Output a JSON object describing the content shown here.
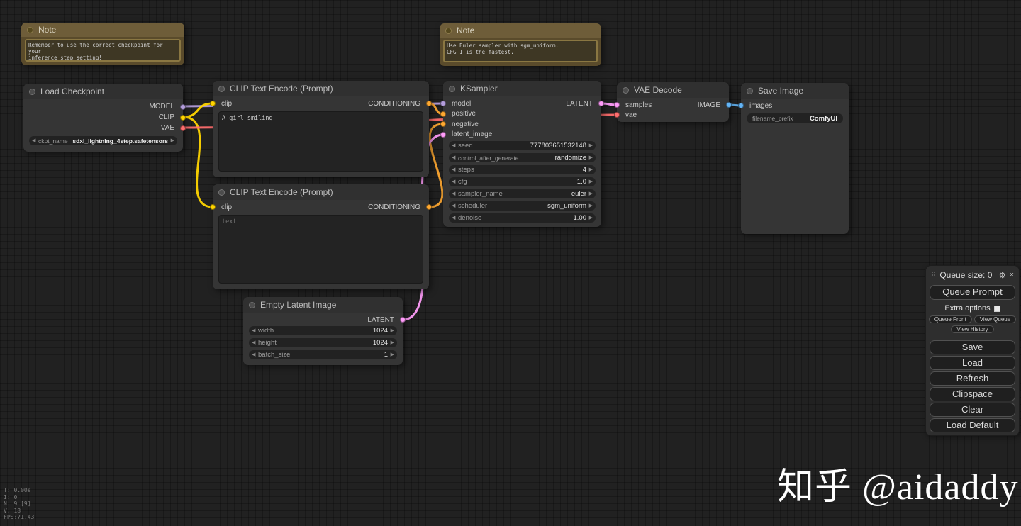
{
  "icons": {
    "left_arrow": "◀",
    "right_arrow": "▶",
    "gear": "⚙",
    "close": "×",
    "drag_handle": "⠿"
  },
  "colors": {
    "model": "#B39DDB",
    "clip": "#FFD500",
    "vae": "#FF6E6E",
    "conditioning": "#FFA931",
    "latent": "#FF9CF9",
    "image": "#64B5F6"
  },
  "nodes": {
    "note1": {
      "title": "Note",
      "text": "Remember to use the correct checkpoint for your\ninference step setting!"
    },
    "note2": {
      "title": "Note",
      "text": "Use Euler sampler with sgm_uniform.\nCFG 1 is the fastest."
    },
    "load_checkpoint": {
      "title": "Load Checkpoint",
      "outputs": [
        "MODEL",
        "CLIP",
        "VAE"
      ],
      "widgets": [
        {
          "label": "ckpt_name",
          "value": "sdxl_lightning_4step.safetensors"
        }
      ]
    },
    "clip_text_positive": {
      "title": "CLIP Text Encode (Prompt)",
      "input": "clip",
      "output": "CONDITIONING",
      "text": "A girl smiling"
    },
    "clip_text_negative": {
      "title": "CLIP Text Encode (Prompt)",
      "input": "clip",
      "output": "CONDITIONING",
      "text": "text"
    },
    "empty_latent_image": {
      "title": "Empty Latent Image",
      "output": "LATENT",
      "widgets": [
        {
          "label": "width",
          "value": "1024"
        },
        {
          "label": "height",
          "value": "1024"
        },
        {
          "label": "batch_size",
          "value": "1"
        }
      ]
    },
    "ksampler": {
      "title": "KSampler",
      "inputs": [
        "model",
        "positive",
        "negative",
        "latent_image"
      ],
      "output": "LATENT",
      "widgets": [
        {
          "label": "seed",
          "value": "777803651532148"
        },
        {
          "label": "control_after_generate",
          "value": "randomize"
        },
        {
          "label": "steps",
          "value": "4"
        },
        {
          "label": "cfg",
          "value": "1.0"
        },
        {
          "label": "sampler_name",
          "value": "euler"
        },
        {
          "label": "scheduler",
          "value": "sgm_uniform"
        },
        {
          "label": "denoise",
          "value": "1.00"
        }
      ]
    },
    "vae_decode": {
      "title": "VAE Decode",
      "inputs": [
        "samples",
        "vae"
      ],
      "output": "IMAGE"
    },
    "save_image": {
      "title": "Save Image",
      "input": "images",
      "widgets": [
        {
          "label": "filename_prefix",
          "value": "ComfyUI"
        }
      ]
    }
  },
  "menu": {
    "queue_size": "Queue size: 0",
    "queue_prompt": "Queue Prompt",
    "extra_options_label": "Extra options",
    "small_buttons": [
      "Queue Front",
      "View Queue",
      "View History"
    ],
    "buttons": [
      "Save",
      "Load",
      "Refresh",
      "Clipspace",
      "Clear",
      "Load Default"
    ]
  },
  "stats": [
    "T: 0.00s",
    "I: 0",
    "N: 9 [9]",
    "V: 18",
    "FPS:71.43"
  ],
  "watermark": "知乎 @aidaddy"
}
